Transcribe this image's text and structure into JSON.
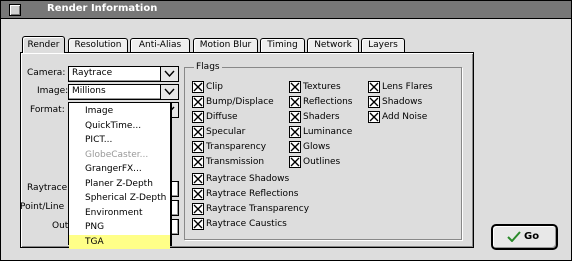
{
  "window": {
    "title": "Render Information"
  },
  "tabs": [
    {
      "label": "Render",
      "active": true
    },
    {
      "label": "Resolution"
    },
    {
      "label": "Anti-Alias"
    },
    {
      "label": "Motion Blur"
    },
    {
      "label": "Timing"
    },
    {
      "label": "Network"
    },
    {
      "label": "Layers"
    }
  ],
  "camera": {
    "label": "Camera:",
    "value": "Raytrace"
  },
  "image": {
    "label": "Image:",
    "value": "Millions"
  },
  "format": {
    "label": "Format:"
  },
  "partial_labels": {
    "raytrace": "Raytrace",
    "point_line": "Point/Line",
    "output": "Outp"
  },
  "flags": {
    "title": "Flags",
    "col1": [
      {
        "label": "Clip",
        "checked": true
      },
      {
        "label": "Bump/Displace",
        "checked": true
      },
      {
        "label": "Diffuse",
        "checked": true
      },
      {
        "label": "Specular",
        "checked": true
      },
      {
        "label": "Transparency",
        "checked": true
      },
      {
        "label": "Transmission",
        "checked": true
      }
    ],
    "col2": [
      {
        "label": "Textures",
        "checked": true
      },
      {
        "label": "Reflections",
        "checked": true
      },
      {
        "label": "Shaders",
        "checked": true
      },
      {
        "label": "Luminance",
        "checked": true
      },
      {
        "label": "Glows",
        "checked": true
      },
      {
        "label": "Outlines",
        "checked": true
      }
    ],
    "col3": [
      {
        "label": "Lens Flares",
        "checked": true
      },
      {
        "label": "Shadows",
        "checked": true
      },
      {
        "label": "Add Noise",
        "checked": true
      }
    ],
    "raytrace": [
      {
        "label": "Raytrace Shadows",
        "checked": true
      },
      {
        "label": "Raytrace Reflections",
        "checked": true
      },
      {
        "label": "Raytrace Transparency",
        "checked": true
      },
      {
        "label": "Raytrace Caustics",
        "checked": true
      }
    ]
  },
  "format_menu": {
    "items": [
      {
        "label": "Image"
      },
      {
        "label": "QuickTime..."
      },
      {
        "label": "PICT..."
      },
      {
        "label": "GlobeCaster...",
        "disabled": true
      },
      {
        "label": "GrangerFX..."
      },
      {
        "label": "Planer Z-Depth"
      },
      {
        "label": "Spherical Z-Depth"
      },
      {
        "label": "Environment"
      },
      {
        "label": "PNG"
      },
      {
        "label": "TGA",
        "selected": true
      }
    ]
  },
  "go_button": {
    "label": "Go",
    "icon": "checkmark-icon"
  }
}
